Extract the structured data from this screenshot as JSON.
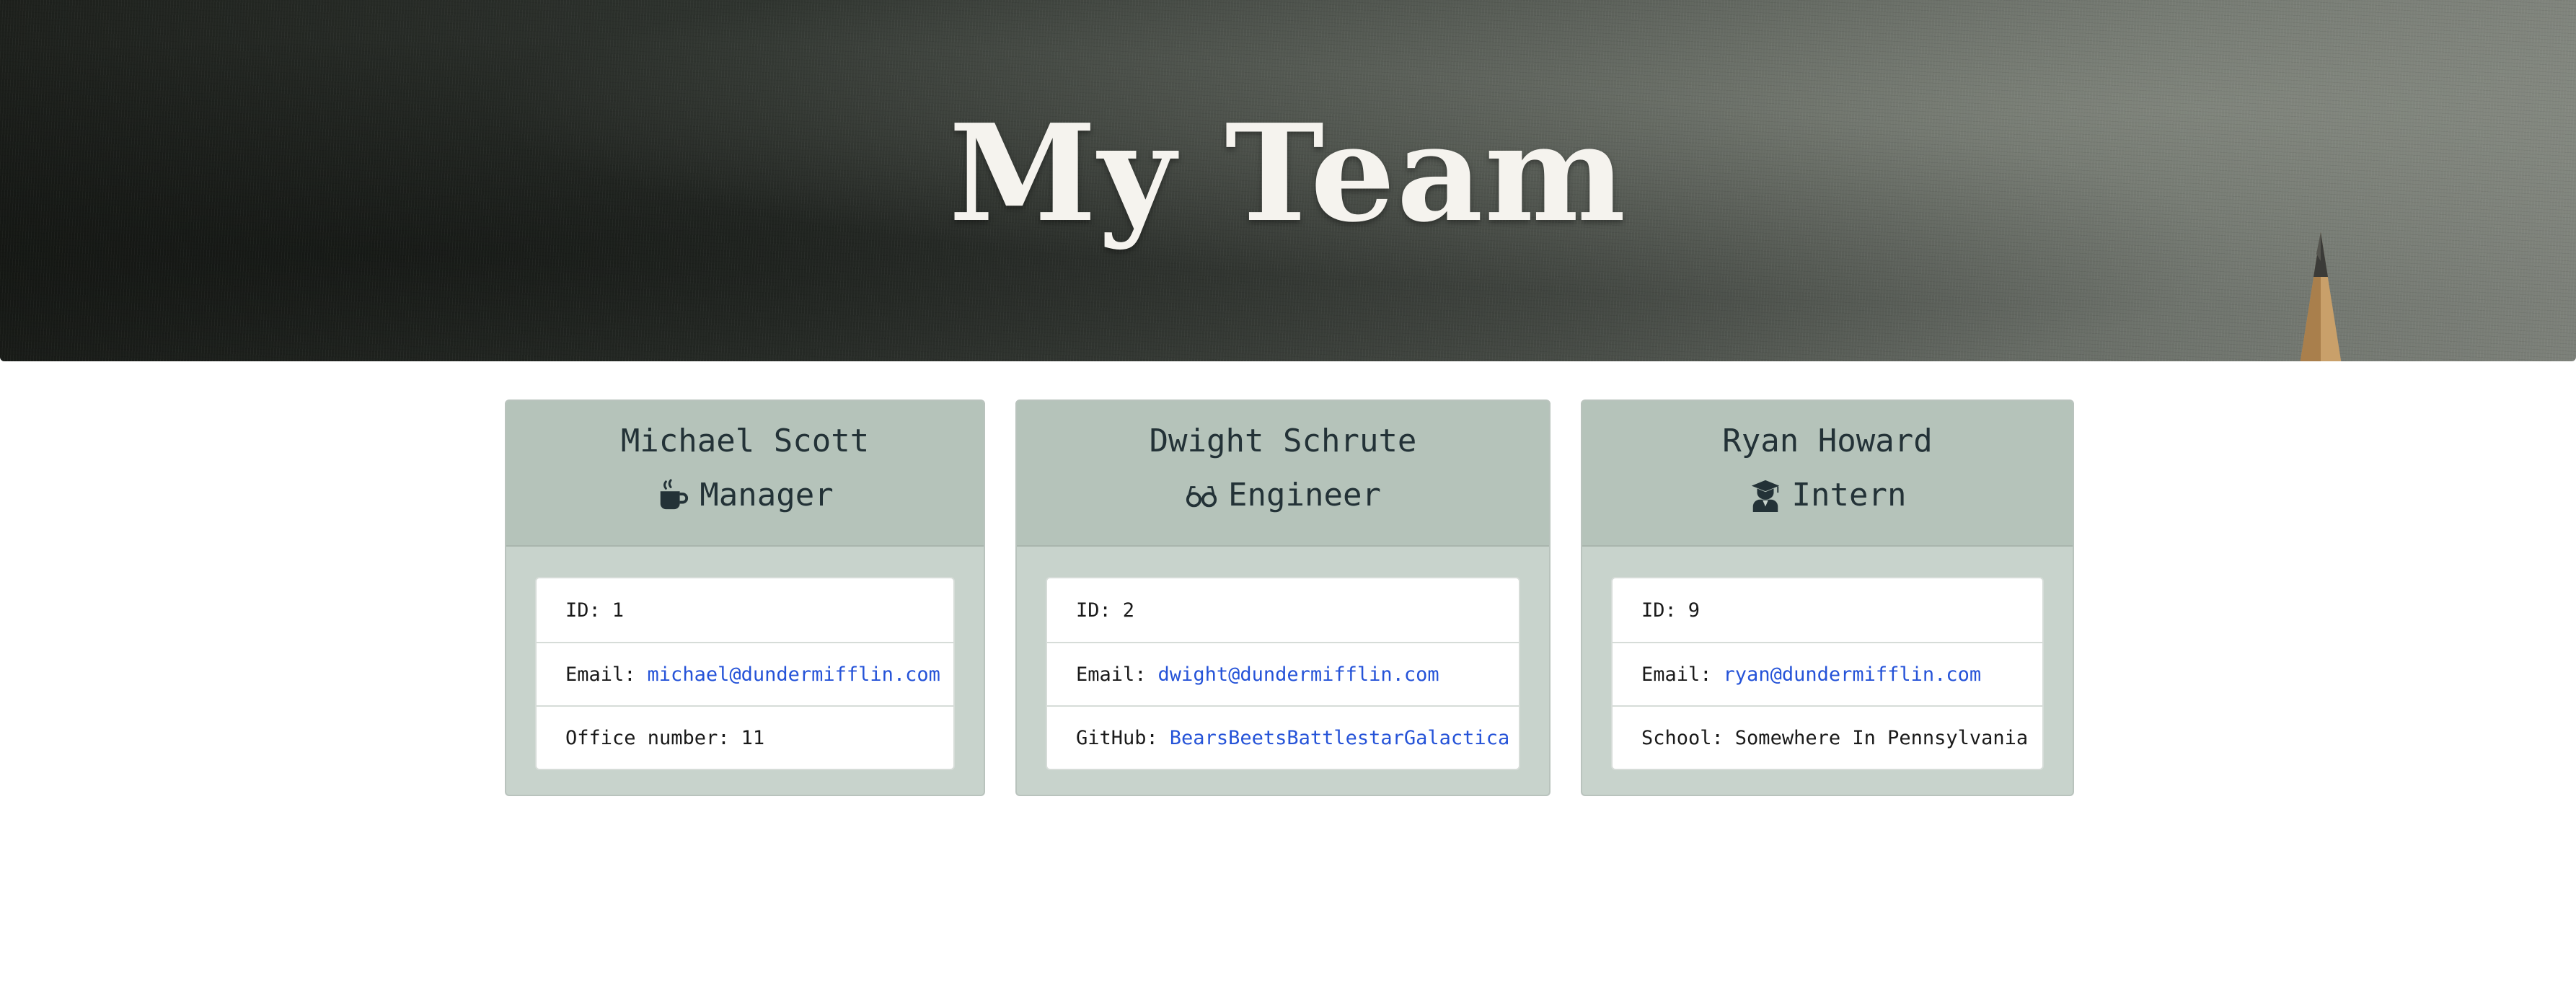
{
  "header": {
    "title": "My Team"
  },
  "team": [
    {
      "name": "Michael Scott",
      "role": "Manager",
      "role_icon": "coffee-mug-icon",
      "fields": [
        {
          "label": "ID:",
          "value": "1"
        },
        {
          "label": "Email:",
          "value": "michael@dundermifflin.com",
          "link": true
        },
        {
          "label": "Office number:",
          "value": "11"
        }
      ]
    },
    {
      "name": "Dwight Schrute",
      "role": "Engineer",
      "role_icon": "glasses-icon",
      "fields": [
        {
          "label": "ID:",
          "value": "2"
        },
        {
          "label": "Email:",
          "value": "dwight@dundermifflin.com",
          "link": true
        },
        {
          "label": "GitHub:",
          "value": "BearsBeetsBattlestarGalactica",
          "link": true
        }
      ]
    },
    {
      "name": "Ryan Howard",
      "role": "Intern",
      "role_icon": "graduate-icon",
      "fields": [
        {
          "label": "ID:",
          "value": "9"
        },
        {
          "label": "Email:",
          "value": "ryan@dundermifflin.com",
          "link": true
        },
        {
          "label": "School:",
          "value": "Somewhere In Pennsylvania"
        }
      ]
    }
  ],
  "colors": {
    "card_body": "#c8d3cc",
    "card_header": "#b5c3ba",
    "header_text": "#233237",
    "link": "#2553d8",
    "title_text": "#f5f3ee"
  }
}
